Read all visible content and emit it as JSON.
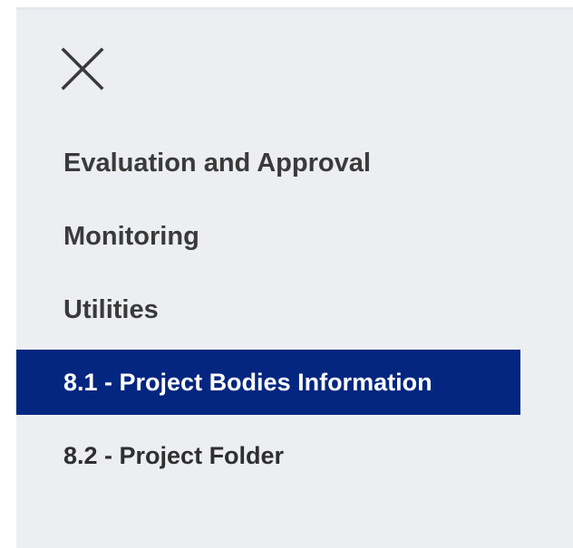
{
  "nav": {
    "close_icon": "close-icon",
    "items": [
      {
        "label": "Evaluation and Approval"
      },
      {
        "label": "Monitoring"
      },
      {
        "label": "Utilities"
      },
      {
        "label": "8.1 - Project Bodies Information"
      },
      {
        "label": "8.2 - Project Folder"
      }
    ]
  },
  "colors": {
    "panel_bg": "#eceef2",
    "active_bg": "#042680",
    "active_text": "#ffffff",
    "text": "#3a3a3a"
  }
}
